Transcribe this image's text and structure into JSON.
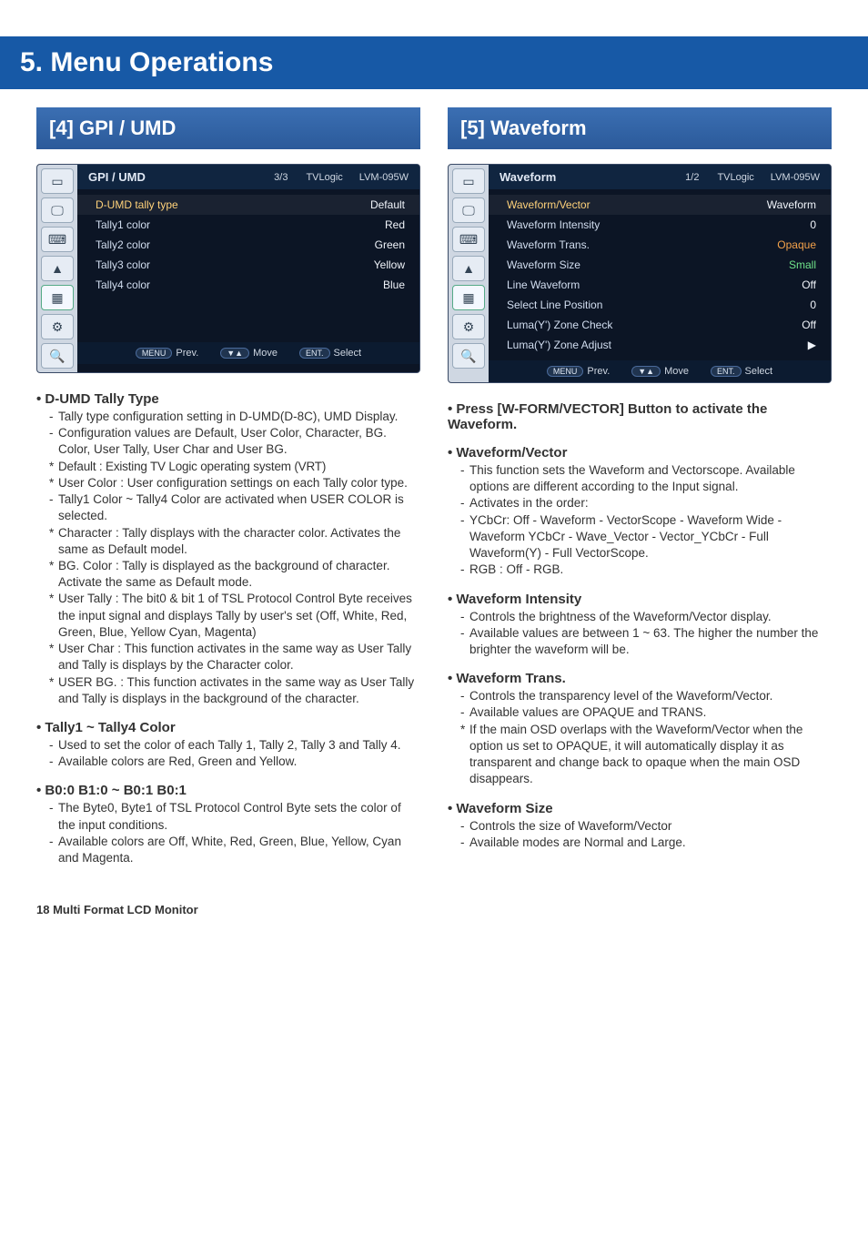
{
  "header": {
    "chapter_title": "5. Menu Operations"
  },
  "left": {
    "section_title": "[4] GPI / UMD",
    "osd": {
      "title": "GPI / UMD",
      "page": "3/3",
      "brand": "TVLogic",
      "model": "LVM-095W",
      "rows": [
        {
          "label": "D-UMD tally type",
          "value": "Default",
          "hl": true
        },
        {
          "label": "Tally1 color",
          "value": "Red"
        },
        {
          "label": "Tally2 color",
          "value": "Green"
        },
        {
          "label": "Tally3 color",
          "value": "Yellow"
        },
        {
          "label": "Tally4 color",
          "value": "Blue"
        }
      ],
      "footer_prev_badge": "MENU",
      "footer_prev": "Prev.",
      "footer_move_badge": "▼▲",
      "footer_move": "Move",
      "footer_sel_badge": "ENT.",
      "footer_sel": "Select"
    },
    "items": [
      {
        "title": "D-UMD Tally Type",
        "lines": [
          {
            "m": "-",
            "t": "Tally type configuration setting in D-UMD(D-8C), UMD Display."
          },
          {
            "m": "-",
            "t": "Configuration values are Default, User Color, Character, BG. Color, User Tally, User Char and User BG."
          },
          {
            "m": "*",
            "t": "Default : Existing TV Logic operating system (VRT)",
            "tight": true
          },
          {
            "m": "*",
            "t": "User Color : User configuration settings on each Tally color type."
          },
          {
            "m": "-",
            "t": "Tally1 Color ~ Tally4 Color are activated when USER COLOR is selected."
          },
          {
            "m": "*",
            "t": "Character : Tally displays with the character color. Activates the same as Default model."
          },
          {
            "m": "*",
            "t": "BG. Color : Tally is displayed as the background of character. Activate the same as Default mode."
          },
          {
            "m": "*",
            "t": "User Tally : The bit0 & bit 1 of TSL Protocol Control Byte receives the input signal and displays Tally by user's set (Off, White, Red, Green, Blue, Yellow Cyan, Magenta)"
          },
          {
            "m": "*",
            "t": "User Char : This function activates in the same way as User Tally and Tally is displays by the Character color."
          },
          {
            "m": "*",
            "t": "USER BG. : This function activates in the same way as User Tally and Tally is displays in the background of the character."
          }
        ]
      },
      {
        "title": "Tally1 ~ Tally4 Color",
        "lines": [
          {
            "m": "-",
            "t": "Used to set the color of each Tally 1, Tally 2, Tally 3 and Tally 4."
          },
          {
            "m": "-",
            "t": "Available colors are Red, Green and Yellow."
          }
        ]
      },
      {
        "title": "B0:0 B1:0 ~ B0:1 B0:1",
        "lines": [
          {
            "m": "-",
            "t": "The Byte0, Byte1 of TSL Protocol Control Byte sets the color of the input conditions."
          },
          {
            "m": "-",
            "t": "Available colors are Off, White, Red, Green, Blue, Yellow, Cyan and Magenta."
          }
        ]
      }
    ]
  },
  "right": {
    "section_title": "[5] Waveform",
    "osd": {
      "title": "Waveform",
      "page": "1/2",
      "brand": "TVLogic",
      "model": "LVM-095W",
      "rows": [
        {
          "label": "Waveform/Vector",
          "value": "Waveform",
          "hl": true
        },
        {
          "label": "Waveform Intensity",
          "value": "0"
        },
        {
          "label": "Waveform Trans.",
          "value": "Opaque",
          "orange": true
        },
        {
          "label": "Waveform Size",
          "value": "Small",
          "green": true
        },
        {
          "label": "Line Waveform",
          "value": "Off"
        },
        {
          "label": "Select Line Position",
          "value": "0"
        },
        {
          "label": "Luma(Y') Zone Check",
          "value": "Off"
        },
        {
          "label": "Luma(Y') Zone Adjust",
          "value": "▶"
        }
      ],
      "footer_prev_badge": "MENU",
      "footer_prev": "Prev.",
      "footer_move_badge": "▼▲",
      "footer_move": "Move",
      "footer_sel_badge": "ENT.",
      "footer_sel": "Select"
    },
    "items": [
      {
        "title": "Press [W-FORM/VECTOR] Button to activate the Waveform.",
        "lines": []
      },
      {
        "title": "Waveform/Vector",
        "lines": [
          {
            "m": "-",
            "t": "This function sets the Waveform and Vectorscope. Available options are different according to the Input signal."
          },
          {
            "m": "-",
            "t": "Activates in the order:"
          },
          {
            "m": "-",
            "t": "YCbCr: Off - Waveform - VectorScope - Waveform Wide - Waveform YCbCr - Wave_Vector - Vector_YCbCr - Full Waveform(Y) - Full VectorScope."
          },
          {
            "m": "-",
            "t": "RGB : Off - RGB."
          }
        ]
      },
      {
        "title": "Waveform Intensity",
        "lines": [
          {
            "m": "-",
            "t": "Controls the brightness of the Waveform/Vector display."
          },
          {
            "m": "-",
            "t": "Available values are between 1 ~ 63. The higher the number the brighter the waveform will be."
          }
        ]
      },
      {
        "title": "Waveform Trans.",
        "lines": [
          {
            "m": "-",
            "t": "Controls the transparency level of the Waveform/Vector."
          },
          {
            "m": "-",
            "t": "Available values are OPAQUE and TRANS."
          },
          {
            "m": "*",
            "t": "If the main OSD overlaps with the Waveform/Vector when the option us set to OPAQUE, it will automatically display it as transparent and change back to opaque when the main OSD disappears."
          }
        ]
      },
      {
        "title": "Waveform Size",
        "lines": [
          {
            "m": "-",
            "t": "Controls the size of Waveform/Vector"
          },
          {
            "m": "-",
            "t": "Available modes are Normal and Large."
          }
        ]
      }
    ]
  },
  "footer": {
    "page_label": "18 Multi Format LCD Monitor"
  },
  "sidebar_icons": [
    "▭",
    "🖵",
    "⌨",
    "▲",
    "▦",
    "⚙",
    "🔍"
  ]
}
